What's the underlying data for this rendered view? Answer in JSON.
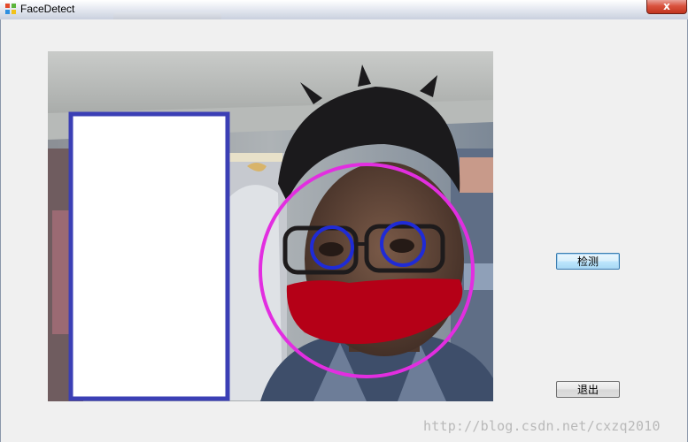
{
  "window": {
    "title": "FaceDetect",
    "close_label": "x",
    "app_icon": "windows-app-icon"
  },
  "image": {
    "description_icon": "webcam-photo",
    "colors": {
      "face_circle": "#e22ee0",
      "eye_circles": "#1f2bd6",
      "mouth_fill": "#b50017",
      "body_rect_outline": "#3b3fb5",
      "body_rect_fill": "#ffffff"
    }
  },
  "buttons": {
    "detect_label": "检测",
    "exit_label": "退出"
  },
  "watermark": {
    "text": "http://blog.csdn.net/cxzq2010"
  }
}
